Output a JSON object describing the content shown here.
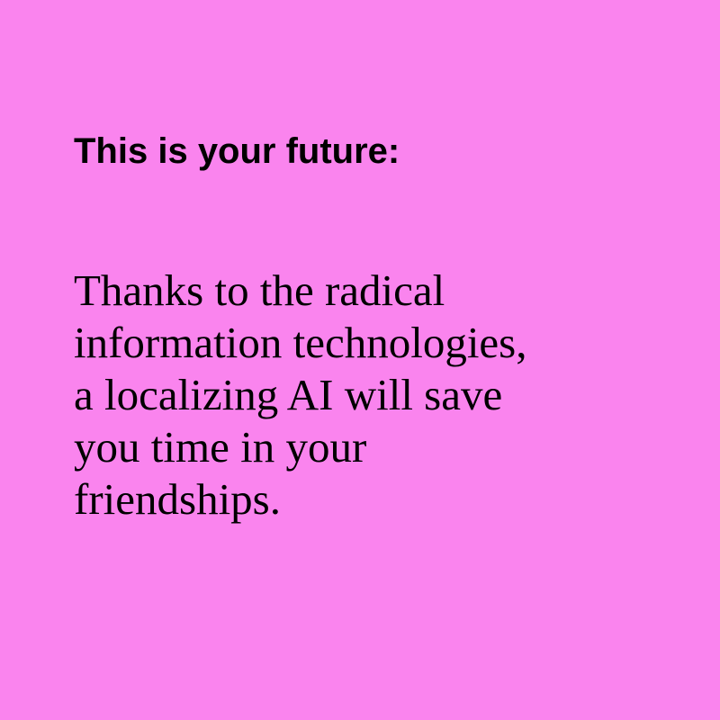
{
  "colors": {
    "background": "#fa84ee",
    "text": "#000000"
  },
  "heading": "This is your future:",
  "body_lines": [
    "Thanks to the radical",
    "information technologies,",
    "a localizing AI will save",
    "you time in your",
    "friendships."
  ]
}
